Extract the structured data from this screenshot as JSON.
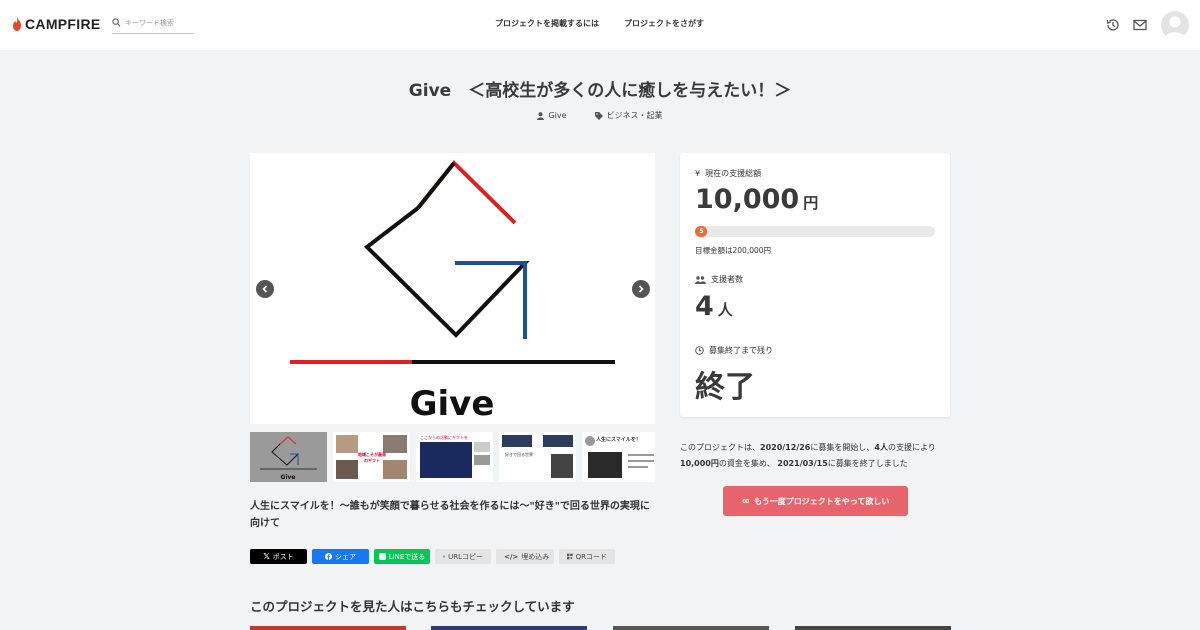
{
  "header": {
    "brand": "CAMPFIRE",
    "search_placeholder": "キーワード検索",
    "nav": [
      "プロジェクトを掲載するには",
      "プロジェクトをさがす"
    ]
  },
  "project": {
    "title": "Give　＜高校生が多くの人に癒しを与えたい！＞",
    "owner": "Give",
    "category": "ビジネス・起業",
    "logo_word": "Give",
    "description": "人生にスマイルを！〜誰もが笑顔で暮らせる社会を作るには〜\"好き\"で回る世界の実現に向けて"
  },
  "thumbnails": [
    "Give",
    "地域こそが最高のギフト",
    "ここからの活動にギフトを",
    "好きで回る世界",
    "人生にスマイルを！"
  ],
  "share": {
    "x": "ポスト",
    "facebook": "シェア",
    "line": "LINEで送る",
    "url_copy": "URLコピー",
    "embed": "埋め込み",
    "qr": "QRコード"
  },
  "stats": {
    "funded_label": "現在の支援総額",
    "funded_value": "10,000",
    "funded_unit": "円",
    "progress_percent": 5,
    "progress_badge": "5",
    "goal_text": "目標金額は200,000円",
    "supporters_label": "支援者数",
    "supporters_value": "4",
    "supporters_unit": "人",
    "remaining_label": "募集終了まで残り",
    "remaining_value": "終了"
  },
  "summary": {
    "p1": "このプロジェクトは、",
    "start": "2020/12/26",
    "p2": "に募集を開始し、",
    "backers": "4人",
    "p3": "の支援により",
    "amount": "10,000円",
    "p4": "の資金を集め、",
    "end": "2021/03/15",
    "p5": "に募集を終了しました"
  },
  "cta_label": "もう一度プロジェクトをやって欲しい",
  "recommend_title": "このプロジェクトを見た人はこちらもチェックしています",
  "colors": {
    "brand_red": "#e8646c",
    "progress": "#ec6b36",
    "logo_red": "#e02020",
    "logo_blue": "#1f4e9c"
  }
}
